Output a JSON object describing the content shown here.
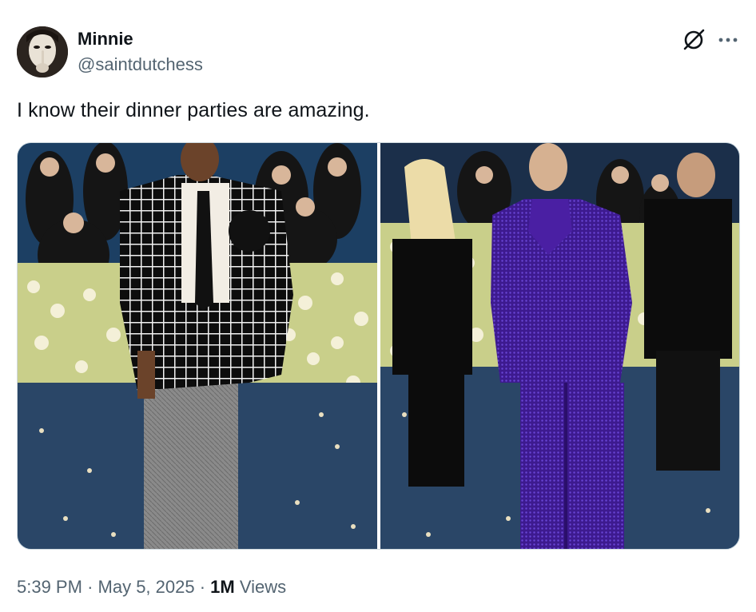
{
  "author": {
    "display_name": "Minnie",
    "handle": "@saintdutchess",
    "avatar_icon": "avatar-woman-finger-lips"
  },
  "header_actions": {
    "grok_icon": "grok-icon",
    "more_icon": "more-icon"
  },
  "tweet": {
    "text": "I know their dinner parties are amazing."
  },
  "media": {
    "photos": [
      {
        "subject": "man in black and white grid jacket with grey trousers"
      },
      {
        "subject": "man in purple sequin suit with purple scarf"
      }
    ]
  },
  "meta": {
    "time": "5:39 PM",
    "separator": "·",
    "date": "May 5, 2025",
    "views_count": "1M",
    "views_label": "Views"
  },
  "colors": {
    "text_primary": "#0f1419",
    "text_secondary": "#536471",
    "border": "#cfd9de"
  }
}
